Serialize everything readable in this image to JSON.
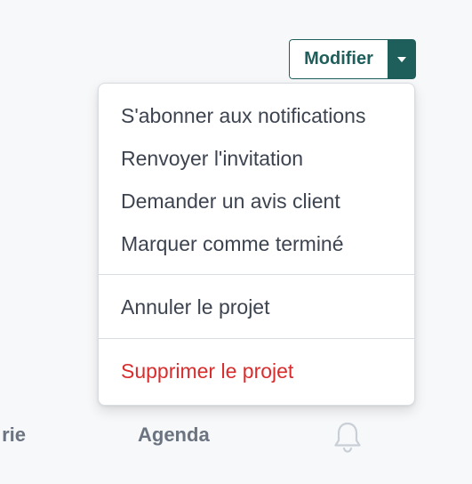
{
  "header": {
    "edit_button_label": "Modifier"
  },
  "menu": {
    "groups": [
      {
        "items": [
          {
            "label": "S'abonner aux notifications"
          },
          {
            "label": "Renvoyer l'invitation"
          },
          {
            "label": "Demander un avis client"
          },
          {
            "label": "Marquer comme terminé"
          }
        ]
      },
      {
        "items": [
          {
            "label": "Annuler le projet"
          }
        ]
      },
      {
        "items": [
          {
            "label": "Supprimer le projet",
            "color": "#d92d2d"
          }
        ]
      }
    ]
  },
  "tabs": {
    "partial_label": "rie",
    "agenda_label": "Agenda",
    "notifications_icon": "bell-icon"
  },
  "colors": {
    "accent": "#1f5f5b",
    "danger": "#d92d2d",
    "text": "#3d4450",
    "muted": "#6b7480"
  }
}
